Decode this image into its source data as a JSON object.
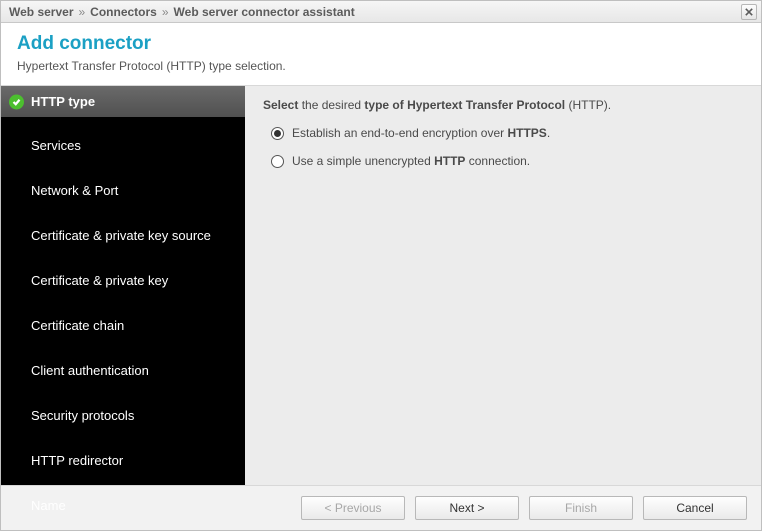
{
  "breadcrumb": {
    "items": [
      "Web server",
      "Connectors",
      "Web server connector assistant"
    ],
    "separator": "»"
  },
  "header": {
    "title": "Add connector",
    "subtitle": "Hypertext Transfer Protocol (HTTP) type selection."
  },
  "sidebar": {
    "steps": [
      "HTTP type",
      "Services",
      "Network & Port",
      "Certificate & private key source",
      "Certificate & private key",
      "Certificate chain",
      "Client authentication",
      "Security protocols",
      "HTTP redirector",
      "Name"
    ],
    "active_index": 0
  },
  "content": {
    "instruction_parts": {
      "p1": "Select",
      "p2": " the desired ",
      "p3": "type of Hypertext Transfer Protocol",
      "p4": " (HTTP)."
    },
    "options": [
      {
        "pre": "Establish an end-to-end encryption over ",
        "bold": "HTTPS",
        "post": ".",
        "selected": true
      },
      {
        "pre": "Use a simple unencrypted ",
        "bold": "HTTP",
        "post": " connection.",
        "selected": false
      }
    ]
  },
  "footer": {
    "previous": "< Previous",
    "next": "Next >",
    "finish": "Finish",
    "cancel": "Cancel"
  }
}
